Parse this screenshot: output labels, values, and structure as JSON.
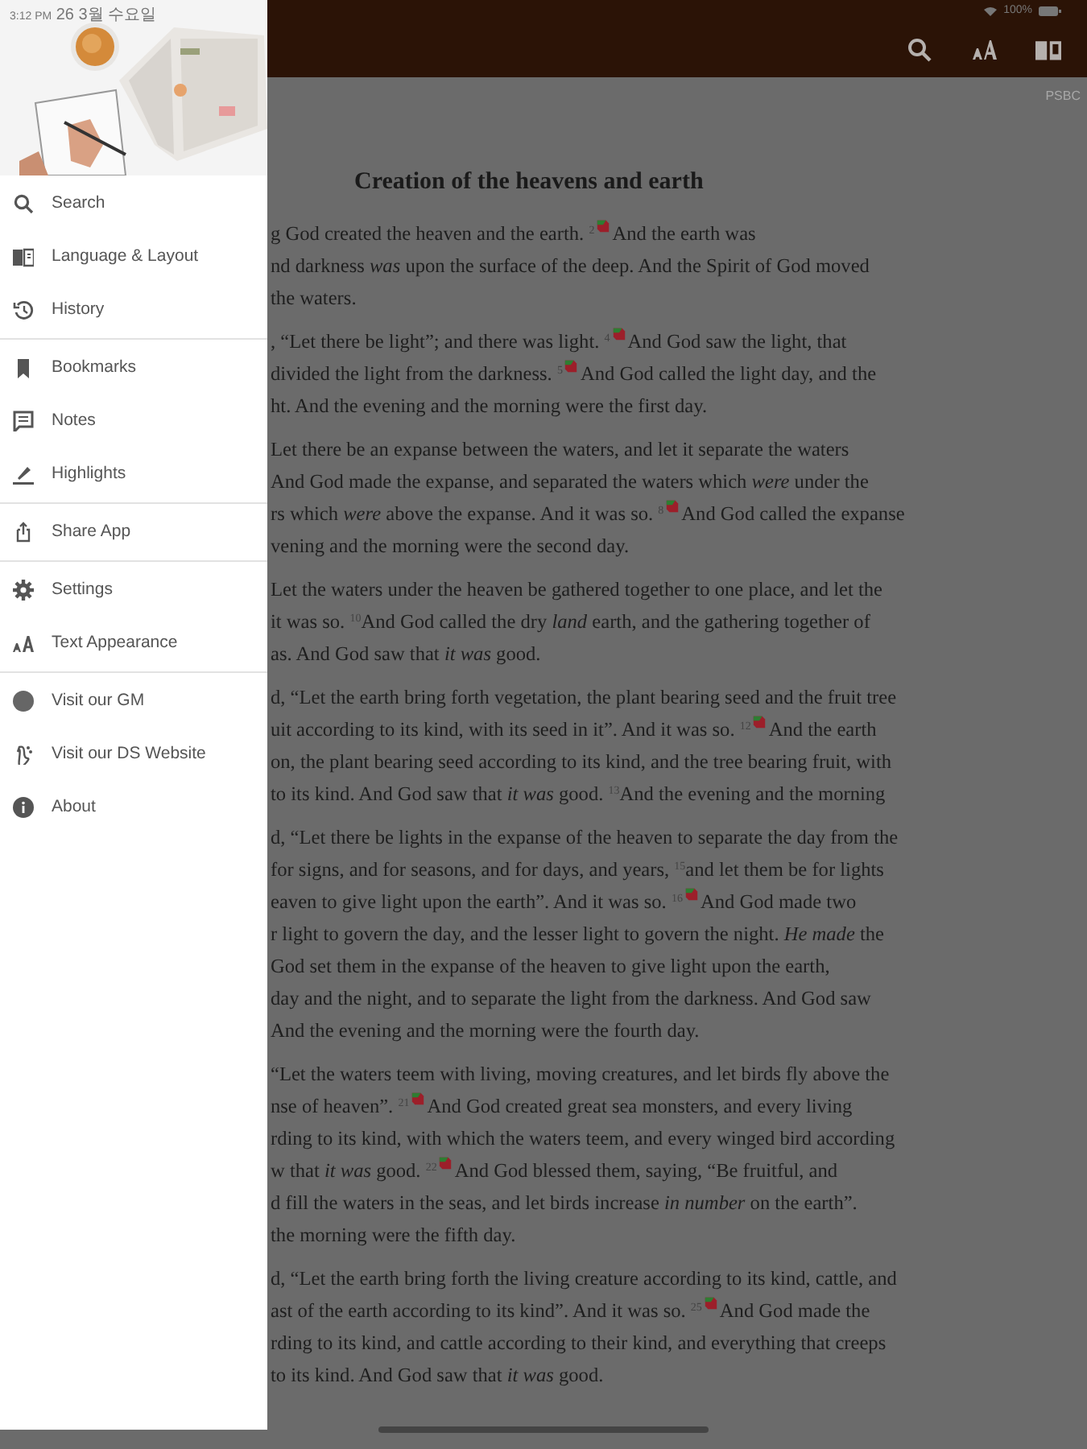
{
  "status_bar": {
    "time": "3:12 PM",
    "date": "26 3월 수요일",
    "battery": "100%"
  },
  "version_label": "PSBC",
  "drawer": {
    "sections": [
      [
        {
          "label": "Search"
        },
        {
          "label": "Language & Layout"
        },
        {
          "label": "History"
        }
      ],
      [
        {
          "label": "Bookmarks"
        },
        {
          "label": "Notes"
        },
        {
          "label": "Highlights"
        }
      ],
      [
        {
          "label": "Share App"
        }
      ],
      [
        {
          "label": "Settings"
        },
        {
          "label": "Text Appearance"
        }
      ],
      [
        {
          "label": "Visit our GM"
        },
        {
          "label": "Visit our DS Website"
        },
        {
          "label": "About"
        }
      ]
    ]
  },
  "chapter": {
    "heading": "Creation of the heavens and earth",
    "paragraphs": [
      [
        [
          {
            "text": "g God created the heaven and the earth. $^{2}$"
          },
          {
            "kind": "note"
          },
          {
            "text": "And the earth was"
          }
        ],
        [
          {
            "text": "nd darkness *was* upon the surface of the deep. And the Spirit of God moved"
          }
        ],
        [
          {
            "text": "the waters."
          }
        ]
      ],
      [
        [
          {
            "text": ", “Let there be light”; and there was light. $^{4}$"
          },
          {
            "kind": "note"
          },
          {
            "text": "And God saw the light, that"
          }
        ],
        [
          {
            "text": "divided the light from the darkness. $^{5}$"
          },
          {
            "kind": "note"
          },
          {
            "text": "And God called the light day, and the"
          }
        ],
        [
          {
            "text": "ht. And the evening and the morning were the first day."
          }
        ]
      ],
      [
        [
          {
            "text": "Let there be an expanse between the waters, and let it separate the waters"
          }
        ],
        [
          {
            "text": "And God made the expanse, and separated the waters which *were* under the"
          }
        ],
        [
          {
            "text": "rs which *were* above the expanse. And it was so. $^{8}$"
          },
          {
            "kind": "note"
          },
          {
            "text": "And God called the expanse"
          }
        ],
        [
          {
            "text": "vening and the morning were the second day."
          }
        ]
      ],
      [
        [
          {
            "text": "Let the waters under the heaven be gathered together to one place, and let the"
          }
        ],
        [
          {
            "text": "it was so. $^{10}$And God called the dry *land* earth, and the gathering together of"
          }
        ],
        [
          {
            "text": "as. And God saw that *it was* good."
          }
        ]
      ],
      [
        [
          {
            "text": "d, “Let the earth bring forth vegetation, the plant bearing seed and the fruit tree"
          }
        ],
        [
          {
            "text": "uit according to its kind, with its seed in it”. And it was so. $^{12}$"
          },
          {
            "kind": "note"
          },
          {
            "text": "And the earth"
          }
        ],
        [
          {
            "text": "on, the plant bearing seed according to its kind, and the tree bearing fruit, with"
          }
        ],
        [
          {
            "text": "to its kind. And God saw that *it was* good. $^{13}$And the evening and the morning"
          }
        ]
      ],
      [
        [
          {
            "text": "d, “Let there be lights in the expanse of the heaven to separate the day from the"
          }
        ],
        [
          {
            "text": "for signs, and for seasons, and for days, and years, $^{15}$and let them be for lights"
          }
        ],
        [
          {
            "text": "eaven to give light upon the earth”. And it was so. $^{16}$"
          },
          {
            "kind": "note"
          },
          {
            "text": "And God made two"
          }
        ],
        [
          {
            "text": "r light to govern the day, and the lesser light to govern the night. *He made* the"
          }
        ],
        [
          {
            "text": "God set them in the expanse of the heaven to give light upon the earth,"
          }
        ],
        [
          {
            "text": "day and the night, and to separate the light from the darkness. And God saw"
          }
        ],
        [
          {
            "text": "And the evening and the morning were the fourth day."
          }
        ]
      ],
      [
        [
          {
            "text": "“Let the waters teem with living, moving creatures, and let birds fly above the"
          }
        ],
        [
          {
            "text": "nse of heaven”. $^{21}$"
          },
          {
            "kind": "note"
          },
          {
            "text": "And God created great sea monsters, and every living"
          }
        ],
        [
          {
            "text": "rding to its kind, with which the waters teem, and every winged bird according"
          }
        ],
        [
          {
            "text": "w that *it was* good. $^{22}$"
          },
          {
            "kind": "note"
          },
          {
            "text": "And God blessed them, saying, “Be fruitful, and"
          }
        ],
        [
          {
            "text": "d fill the waters in the seas, and let birds increase *in number* on the earth”."
          }
        ],
        [
          {
            "text": "the morning were the fifth day."
          }
        ]
      ],
      [
        [
          {
            "text": "d, “Let the earth bring forth the living creature according to its kind, cattle, and"
          }
        ],
        [
          {
            "text": "ast of the earth according to its kind”. And it was so. $^{25}$"
          },
          {
            "kind": "note"
          },
          {
            "text": "And God made the"
          }
        ],
        [
          {
            "text": "rding to its kind, and cattle according to their kind, and everything that creeps"
          }
        ],
        [
          {
            "text": "to its kind. And God saw that *it was* good."
          }
        ]
      ]
    ]
  }
}
